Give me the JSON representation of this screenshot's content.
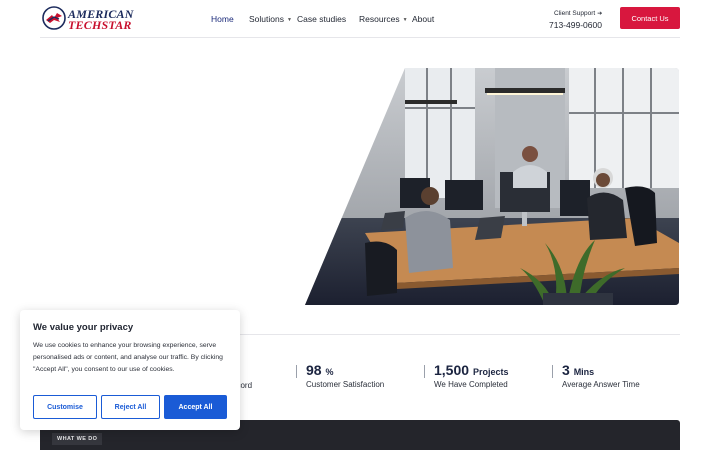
{
  "brand": {
    "line1": "AMERICAN",
    "line2": "TECHSTAR",
    "colors": {
      "navy": "#1b2a5c",
      "red": "#c8102e"
    }
  },
  "nav": [
    {
      "label": "Home",
      "active": true
    },
    {
      "label": "Solutions",
      "dropdown": true
    },
    {
      "label": "Case studies"
    },
    {
      "label": "Resources",
      "dropdown": true
    },
    {
      "label": "About"
    }
  ],
  "support": {
    "label": "Client Support",
    "arrow": "➔",
    "phone": "713-499-0600"
  },
  "contact": {
    "label": "Contact Us",
    "color": "#d8173e"
  },
  "hero": {
    "image": "office-team-photo"
  },
  "stats": {
    "partial_label": "ecord",
    "items": [
      {
        "value": "98",
        "unit": "%",
        "label": "Customer Satisfaction"
      },
      {
        "value": "1,500",
        "unit": "Projects",
        "label": "We Have Completed"
      },
      {
        "value": "3",
        "unit": "Mins",
        "label": "Average Answer Time"
      }
    ]
  },
  "section": {
    "tag": "WHAT WE DO"
  },
  "cookie": {
    "title": "We value your privacy",
    "text": "We use cookies to enhance your browsing experience, serve personalised ads or content, and analyse our traffic. By clicking \"Accept All\", you consent to our use of cookies.",
    "customise": "Customise",
    "reject": "Reject All",
    "accept": "Accept All",
    "accent": "#1a5bd6"
  }
}
